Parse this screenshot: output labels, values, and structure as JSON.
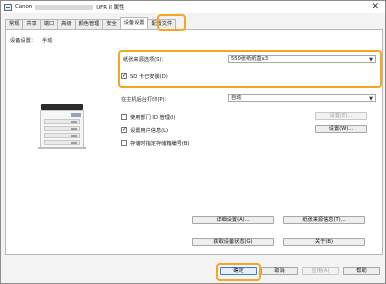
{
  "window": {
    "title_prefix": "Canon",
    "title_suffix": "UFR II 属性"
  },
  "tabs": [
    {
      "label": "常规"
    },
    {
      "label": "共享"
    },
    {
      "label": "端口"
    },
    {
      "label": "高级"
    },
    {
      "label": "颜色管理"
    },
    {
      "label": "安全"
    },
    {
      "label": "设备设置"
    },
    {
      "label": "配置文件"
    }
  ],
  "active_tab": "设备设置",
  "device_settings": {
    "label": "设备设置：",
    "value": "手动"
  },
  "paper_source": {
    "label": "纸张来源选项(S)：",
    "selected": "550张纸纸盒x3"
  },
  "sd_card": {
    "label": "SD 卡已安装(D)",
    "checked": true
  },
  "host_spooling": {
    "label": "在主机后台打印(P)：",
    "selected": "自动"
  },
  "department_id": {
    "label": "使用部门 ID 管理(I)",
    "checked": false,
    "settings_button": "设置(E)..."
  },
  "user_info": {
    "label": "设置用户信息(L)",
    "checked": true,
    "settings_button": "设置(W)..."
  },
  "store_job": {
    "label": "存储时指定存储箱编号(B)",
    "checked": false
  },
  "buttons": {
    "details": "详细设置(A)...",
    "paper_source_info": "纸张来源信息(T)...",
    "get_device_status": "获取设备状态(G)",
    "about": "关于(B)",
    "ok": "确定",
    "cancel": "取消",
    "apply": "应用(A)",
    "help": "帮助"
  },
  "colors": {
    "highlight": "#f5a623",
    "primary_border": "#3c7fd6"
  },
  "icons": {
    "app": "printer-window-icon",
    "close": "close-icon",
    "printer": "printer-illustration"
  }
}
